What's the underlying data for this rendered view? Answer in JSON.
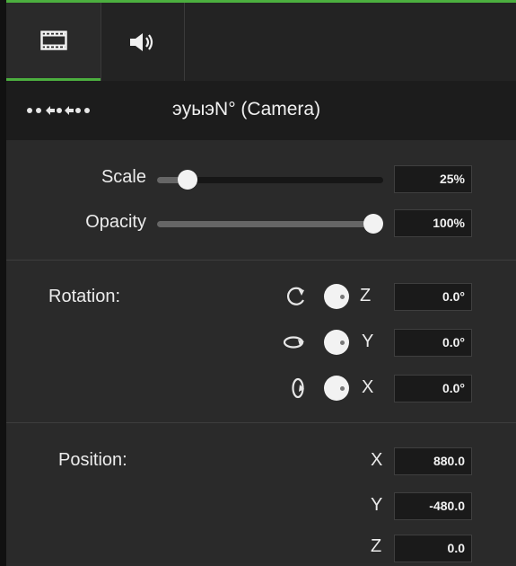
{
  "tabs": [
    {
      "name": "visual-properties",
      "icon": "film-icon",
      "active": true
    },
    {
      "name": "audio-properties",
      "icon": "speaker-icon",
      "active": false
    }
  ],
  "header": {
    "title": "эуыэN° (Camera)",
    "grip_icon": "drag-grip-icon"
  },
  "sliders": {
    "scale": {
      "label": "Scale",
      "value_text": "25%",
      "level": 0.1
    },
    "opacity": {
      "label": "Opacity",
      "value_text": "100%",
      "level": 1.0
    }
  },
  "rotation": {
    "label": "Rotation:",
    "z": {
      "axis": "Z",
      "value": "0.0°",
      "icon": "rotate-z-icon"
    },
    "y": {
      "axis": "Y",
      "value": "0.0°",
      "icon": "rotate-y-icon"
    },
    "x": {
      "axis": "X",
      "value": "0.0°",
      "icon": "rotate-x-icon"
    }
  },
  "position": {
    "label": "Position:",
    "x": {
      "axis": "X",
      "value": "880.0"
    },
    "y": {
      "axis": "Y",
      "value": "-480.0"
    },
    "z": {
      "axis": "Z",
      "value": "0.0"
    }
  },
  "colors": {
    "accent": "#4caf3f",
    "panel_bg": "#2a2a2a",
    "header_bg": "#1c1c1c"
  }
}
